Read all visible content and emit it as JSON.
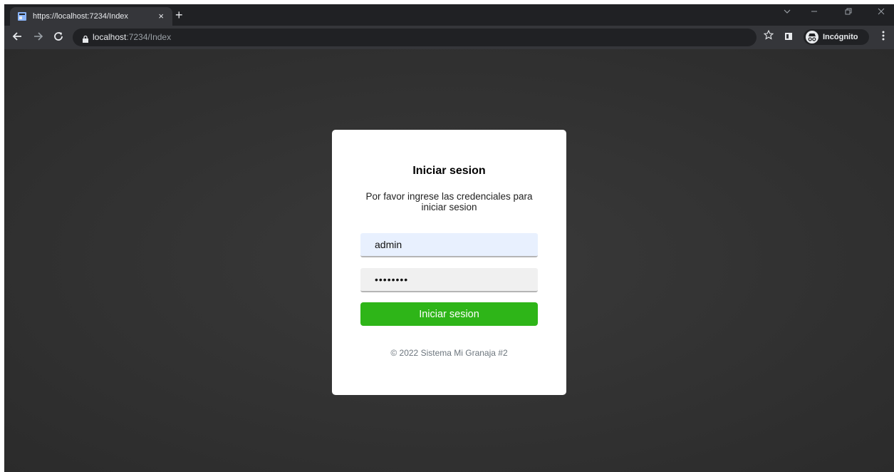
{
  "browser": {
    "tab_title": "https://localhost:7234/Index",
    "tab_close": "×",
    "new_tab": "+",
    "url_host": "localhost",
    "url_rest": ":7234/Index",
    "incognito_label": "Incógnito",
    "icons": [
      "page-icon",
      "close-icon",
      "plus-icon",
      "chevron-down-icon",
      "minimize-icon",
      "restore-icon",
      "close-window-icon",
      "back-icon",
      "forward-icon",
      "reload-icon",
      "lock-icon",
      "star-icon",
      "side-panel-icon",
      "incognito-icon",
      "menu-icon"
    ]
  },
  "login": {
    "title": "Iniciar sesion",
    "subtitle": "Por favor ingrese las credenciales para iniciar sesion",
    "username_value": "admin",
    "password_mask": "••••••••",
    "submit_label": "Iniciar sesion",
    "footer": "© 2022 Sistema Mi Granaja #2"
  },
  "colors": {
    "accent": "#2eb518",
    "background": "#2e2e2e",
    "card": "#ffffff",
    "username_field_bg": "#e8f0fe"
  }
}
